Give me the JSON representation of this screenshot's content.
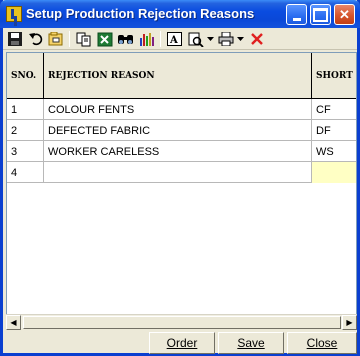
{
  "window": {
    "title": "Setup Production Rejection Reasons"
  },
  "toolbar": {
    "icons": [
      "save-icon",
      "undo-icon",
      "open-icon",
      "copy-icon",
      "excel-icon",
      "find-icon",
      "chart-icon",
      "font-icon",
      "print-preview-icon",
      "print-icon",
      "delete-icon"
    ]
  },
  "grid": {
    "columns": [
      "SNO.",
      "REJECTION REASON",
      "SHORT"
    ],
    "rows": [
      {
        "sno": "1",
        "reason": "COLOUR FENTS",
        "short": "CF"
      },
      {
        "sno": "2",
        "reason": "DEFECTED FABRIC",
        "short": "DF"
      },
      {
        "sno": "3",
        "reason": "WORKER CARELESS",
        "short": "WS"
      },
      {
        "sno": "4",
        "reason": "",
        "short": ""
      }
    ]
  },
  "footer": {
    "order_label": "Order",
    "save_label": "Save",
    "close_label": "Close"
  },
  "colors": {
    "titlebar": "#0a4ce0",
    "current_cell": "#ffffc4"
  }
}
